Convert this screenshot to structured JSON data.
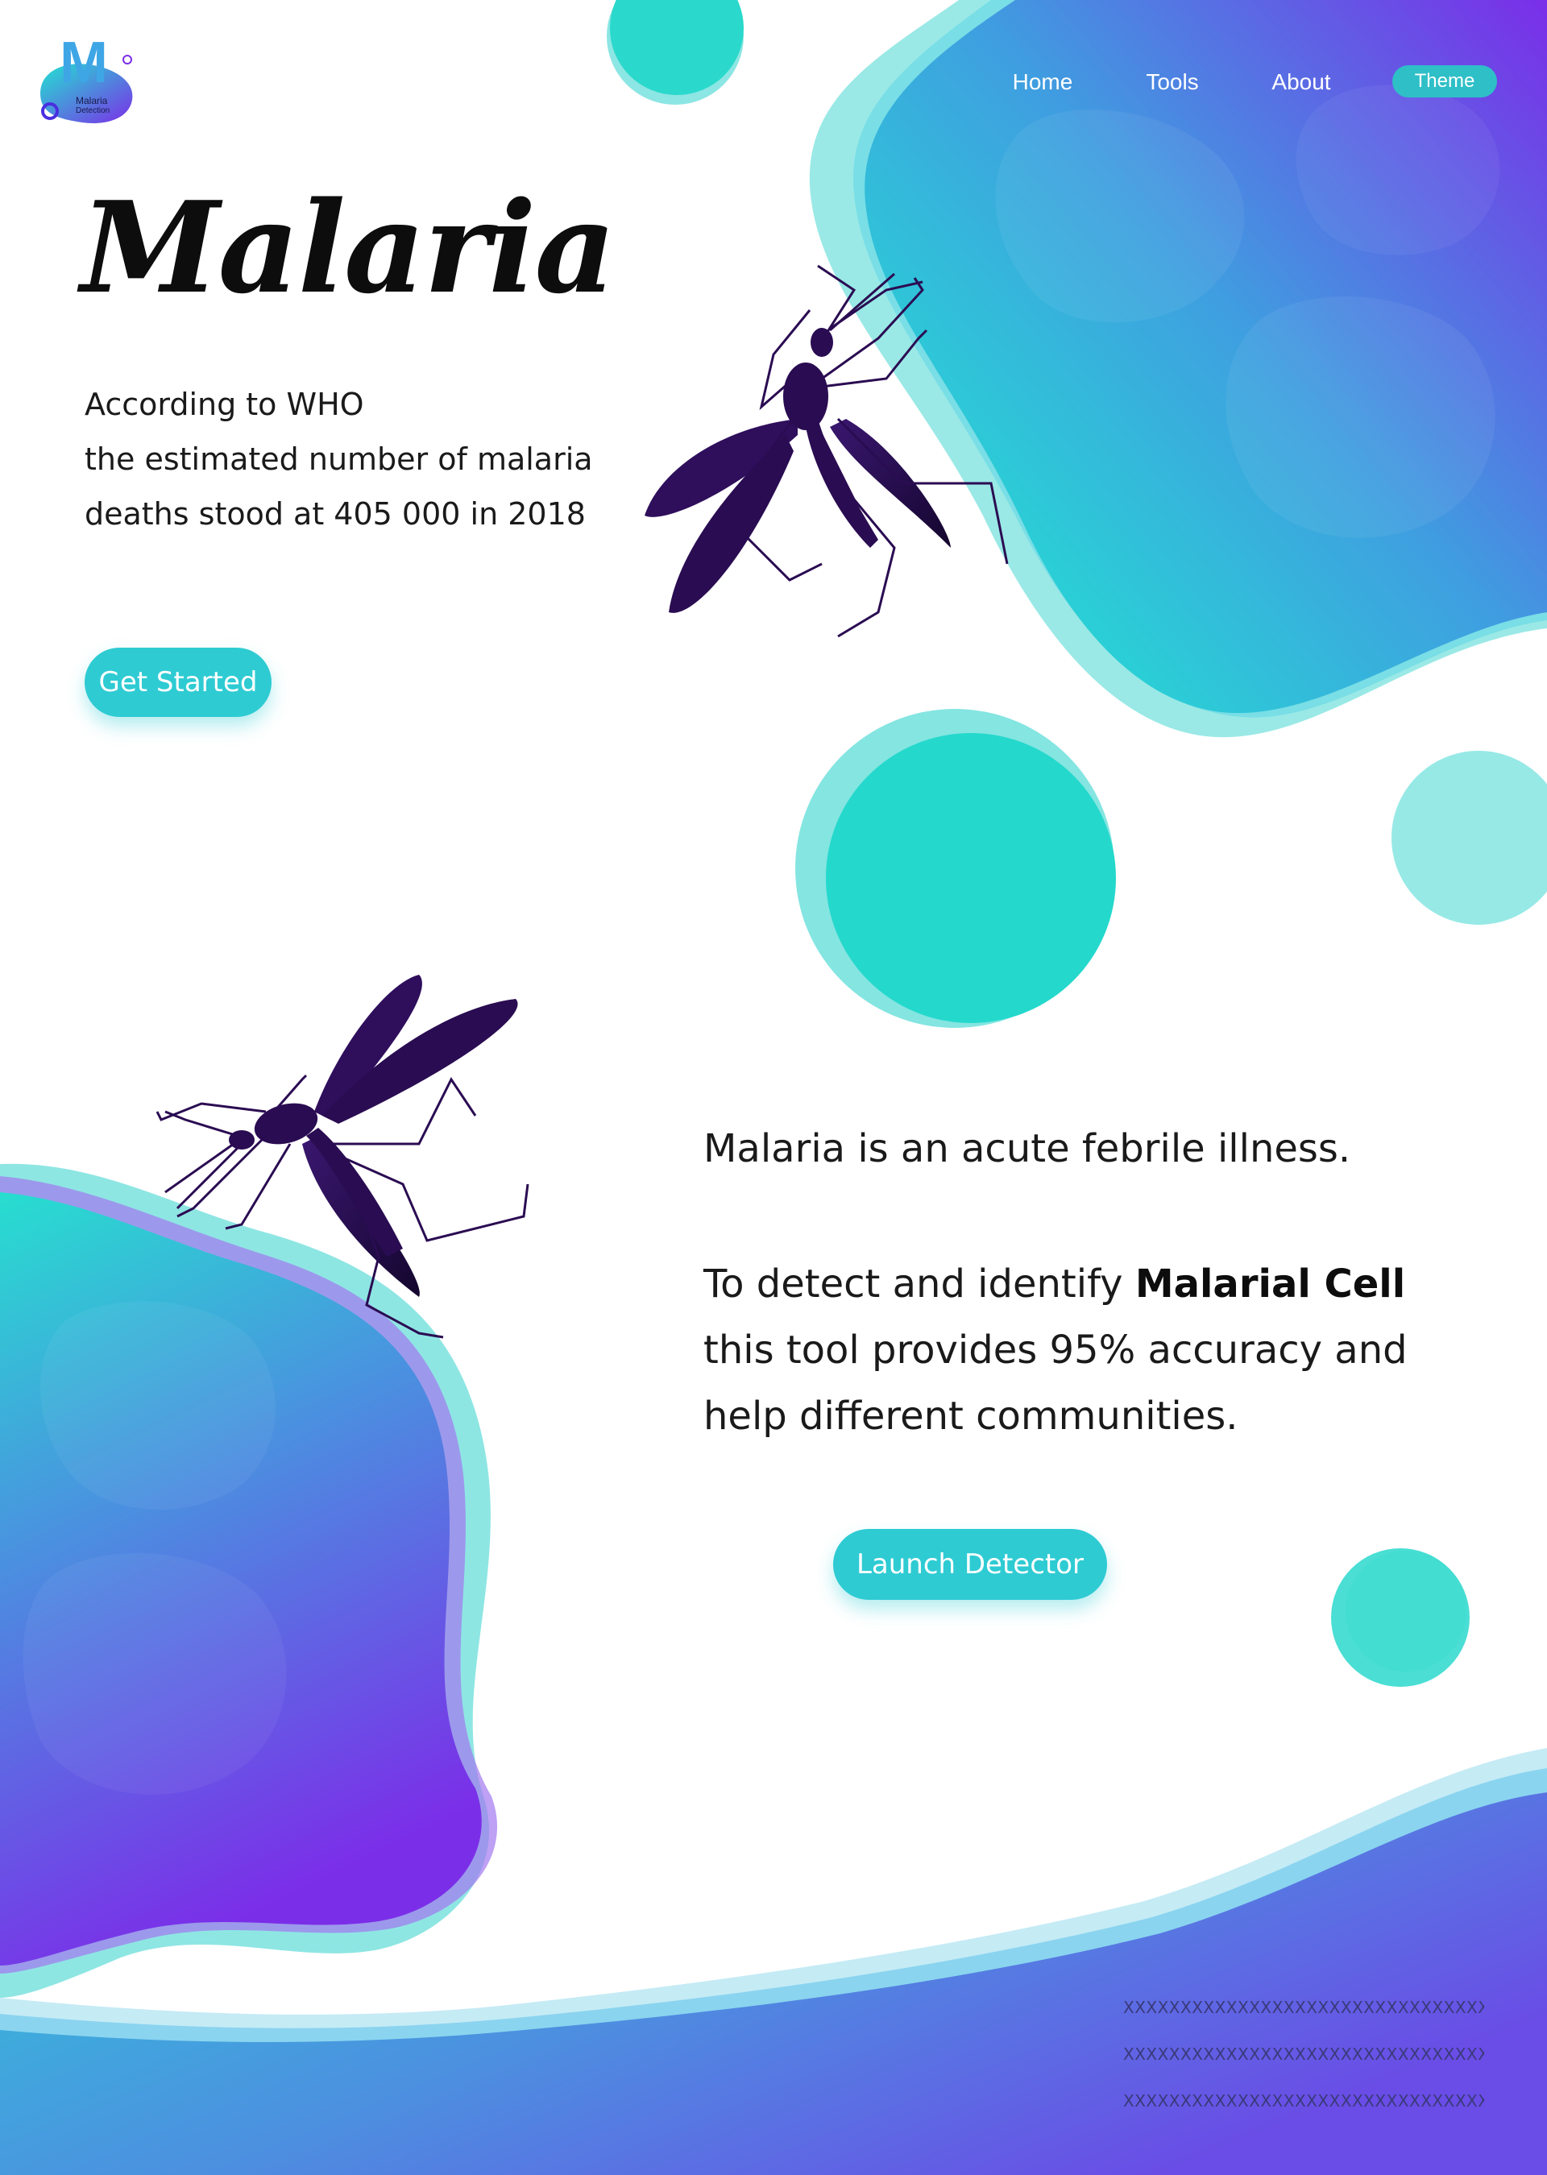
{
  "brand": {
    "logo_text": "M",
    "logo_caption_1": "Malaria",
    "logo_caption_2": "Detection"
  },
  "nav": {
    "home": "Home",
    "tools": "Tools",
    "about": "About",
    "theme": "Theme"
  },
  "hero": {
    "title": "Malaria",
    "lines": [
      "According to WHO",
      "the estimated number of malaria",
      "deaths stood at 405 000 in 2018"
    ],
    "cta": "Get Started"
  },
  "info": {
    "line1": "Malaria is an acute febrile illness.",
    "line2_prefix": "To detect and identify ",
    "line2_bold": "Malarial Cell",
    "line3": "this tool provides 95% accuracy and",
    "line4": "help different communities.",
    "cta": "Launch Detector"
  },
  "footer": {
    "lines": [
      "XXXXXXXXXXXXXXXXXXXXXXXXXXXXXXXXXXXXX",
      "XXXXXXXXXXXXXXXXXXXXXXXXXXXXXXXXXXXXX",
      "XXXXXXXXXXXXXXXXXXXXXXXXXXXXXXXXXXXXX"
    ]
  },
  "colors": {
    "teal": "#2ad8cc",
    "teal_light": "#97e9e6",
    "purple": "#7b2ee8",
    "blue": "#4d8ee0",
    "mosquito": "#2a0c52",
    "button": "#2ecbd3"
  },
  "icons": [
    "mosquito-icon",
    "logo-icon"
  ]
}
